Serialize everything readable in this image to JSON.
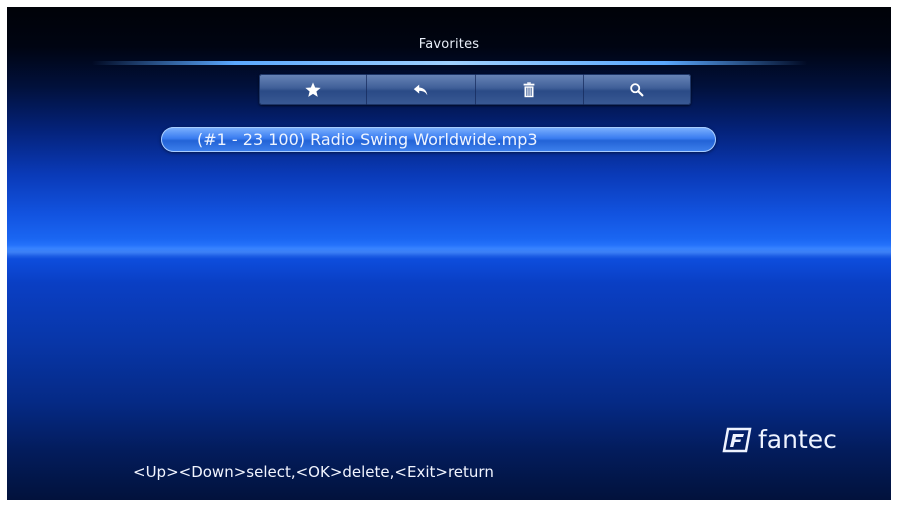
{
  "screen": {
    "title": "Favorites"
  },
  "toolbar": {
    "buttons": [
      {
        "icon": "star-icon"
      },
      {
        "icon": "back-arrow-icon"
      },
      {
        "icon": "trash-icon"
      },
      {
        "icon": "search-icon"
      }
    ]
  },
  "list": {
    "items": [
      {
        "label": "(#1 - 23 100) Radio Swing Worldwide.mp3",
        "selected": true
      }
    ]
  },
  "footer": {
    "hint": "<Up><Down>select,<OK>delete,<Exit>return",
    "logo_text": "fantec",
    "logo_mark": "F"
  },
  "colors": {
    "accent": "#2a6fe8",
    "background": "#0a3fc4",
    "text": "#eef4ff"
  }
}
